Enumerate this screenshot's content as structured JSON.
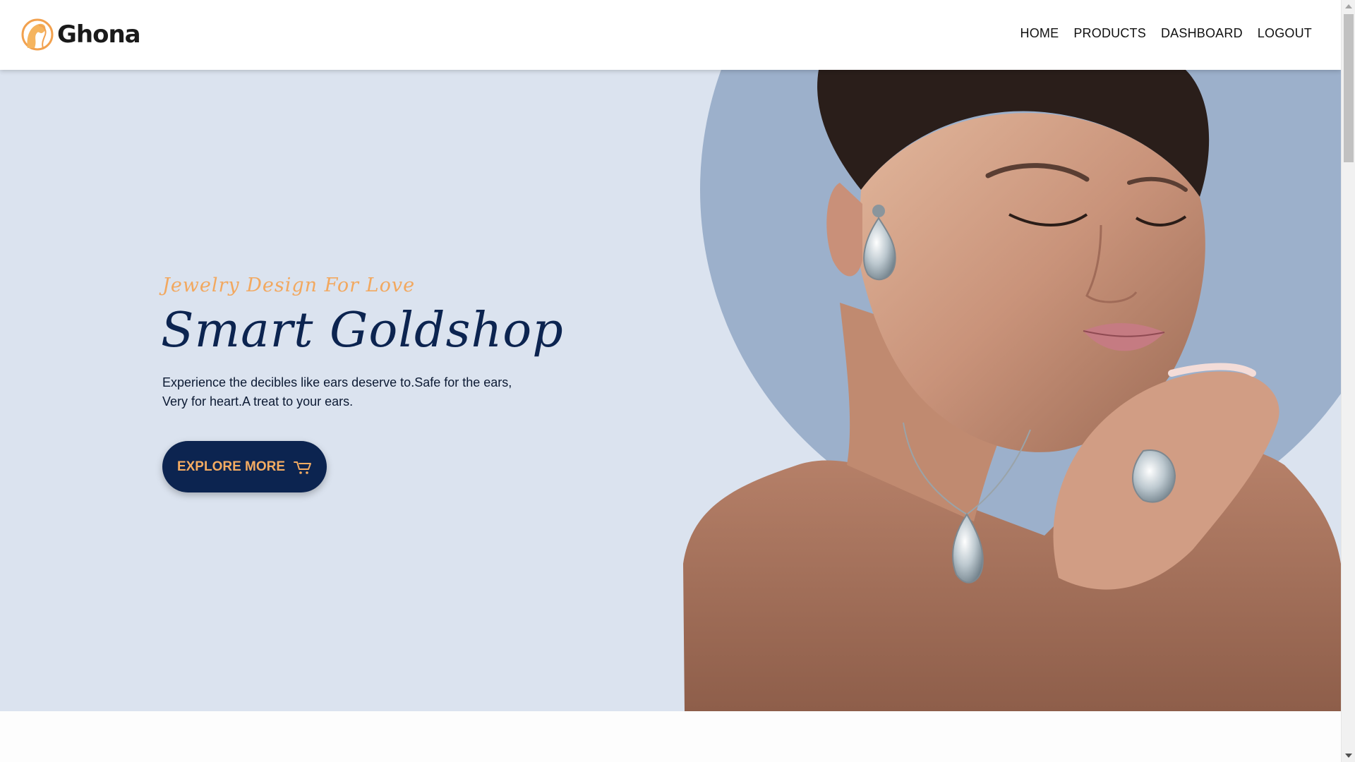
{
  "navbar": {
    "brand": {
      "name": "Ghona",
      "logo_icon": "woman-silhouette-logo"
    },
    "links": [
      "HOME",
      "PRODUCTS",
      "DASHBOARD",
      "LOGOUT"
    ]
  },
  "hero": {
    "tagline": "Jewelry Design For Love",
    "title": "Smart Goldshop",
    "description": "Experience the decibles like ears deserve to.Safe for the ears, Very for heart.A treat to your ears.",
    "cta_label": "EXPLORE MORE",
    "cta_icon": "cart-icon",
    "image_subject": "model-wearing-jewelry-photo"
  },
  "colors": {
    "hero_background": "#dbe3ef",
    "hero_circle": "#9cb0cb",
    "primary_dark": "#0c2450",
    "accent_orange": "#f2a85f"
  }
}
